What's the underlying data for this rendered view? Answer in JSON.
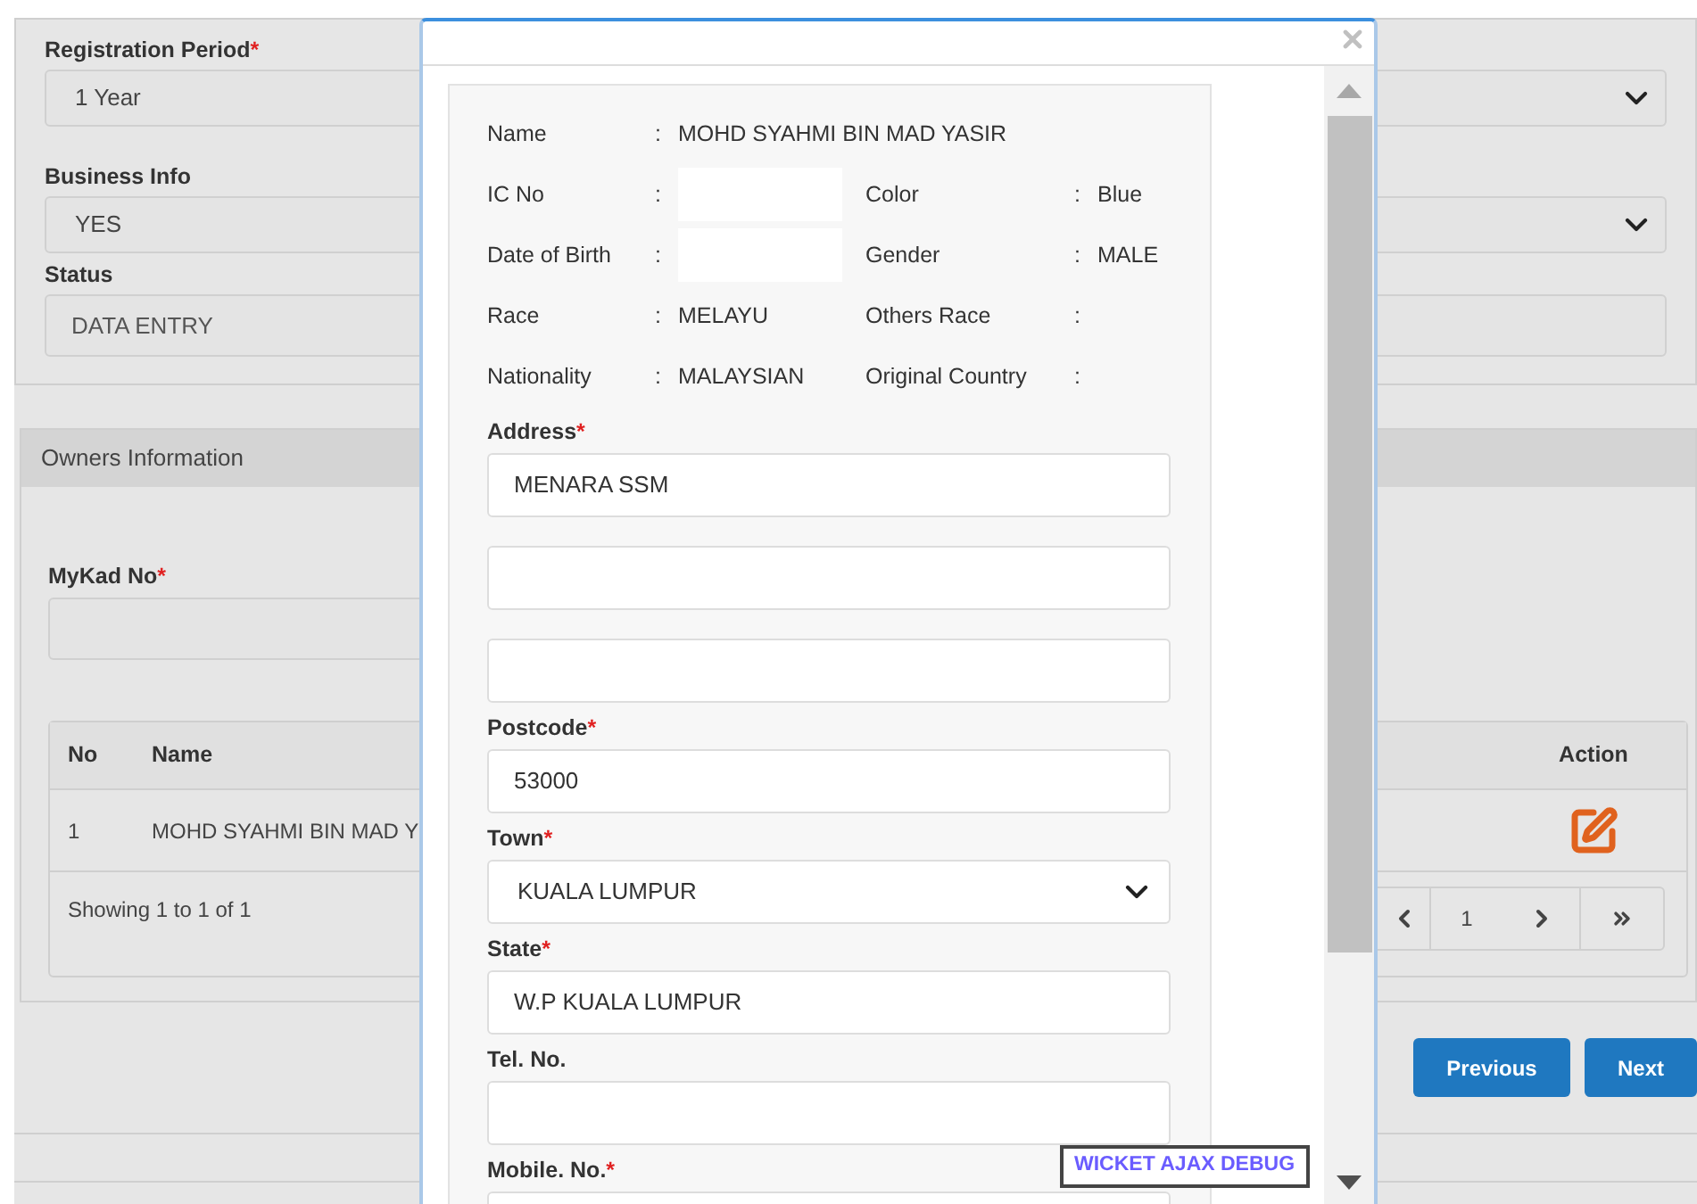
{
  "page": {
    "fields": [
      {
        "label": "Registration Period",
        "required_mark": "*",
        "kind": "select",
        "value": "1 Year"
      },
      {
        "label": "Business Info",
        "kind": "select",
        "value": "YES"
      },
      {
        "label": "Status",
        "kind": "text",
        "value": "DATA ENTRY"
      }
    ],
    "owners_panel": {
      "title": "Owners Information",
      "mykad": {
        "label": "MyKad No",
        "required_mark": "*"
      },
      "table": {
        "columns": [
          "No",
          "Name",
          "Action"
        ],
        "rows": [
          {
            "no": "1",
            "name": "MOHD SYAHMI BIN MAD Y"
          }
        ],
        "footer": "Showing 1 to 1 of 1",
        "current_page": "1"
      }
    },
    "buttons": [
      "Previous",
      "Next"
    ]
  },
  "dialog": {
    "info": [
      {
        "label": "Name",
        "colon": ":",
        "value": "MOHD SYAHMI BIN MAD YASIR"
      },
      {
        "label": "IC No",
        "colon": ":",
        "redacted": true,
        "right": {
          "label": "Color",
          "colon": ":",
          "value": "Blue"
        }
      },
      {
        "label": "Date of Birth",
        "colon": ":",
        "redacted": true,
        "right": {
          "label": "Gender",
          "colon": ":",
          "value": "MALE"
        }
      },
      {
        "label": "Race",
        "colon": ":",
        "value": "MELAYU",
        "right": {
          "label": "Others Race",
          "colon": ":"
        }
      },
      {
        "label": "Nationality",
        "colon": ":",
        "value": "MALAYSIAN",
        "right": {
          "label": "Original Country",
          "colon": ":"
        }
      }
    ],
    "fields": [
      {
        "label": "Address",
        "required_mark": "*",
        "kind": "text",
        "value": "MENARA SSM"
      },
      {
        "kind": "text"
      },
      {
        "kind": "text"
      },
      {
        "label": "Postcode",
        "required_mark": "*",
        "kind": "text",
        "value": "53000"
      },
      {
        "label": "Town",
        "required_mark": "*",
        "kind": "select",
        "value": "KUALA LUMPUR"
      },
      {
        "label": "State",
        "required_mark": "*",
        "kind": "text",
        "value": "W.P KUALA LUMPUR"
      },
      {
        "label": "Tel. No.",
        "kind": "text"
      },
      {
        "label": "Mobile. No.",
        "required_mark": "*",
        "kind": "text"
      }
    ],
    "debug_link": "WICKET AJAX DEBUG"
  }
}
